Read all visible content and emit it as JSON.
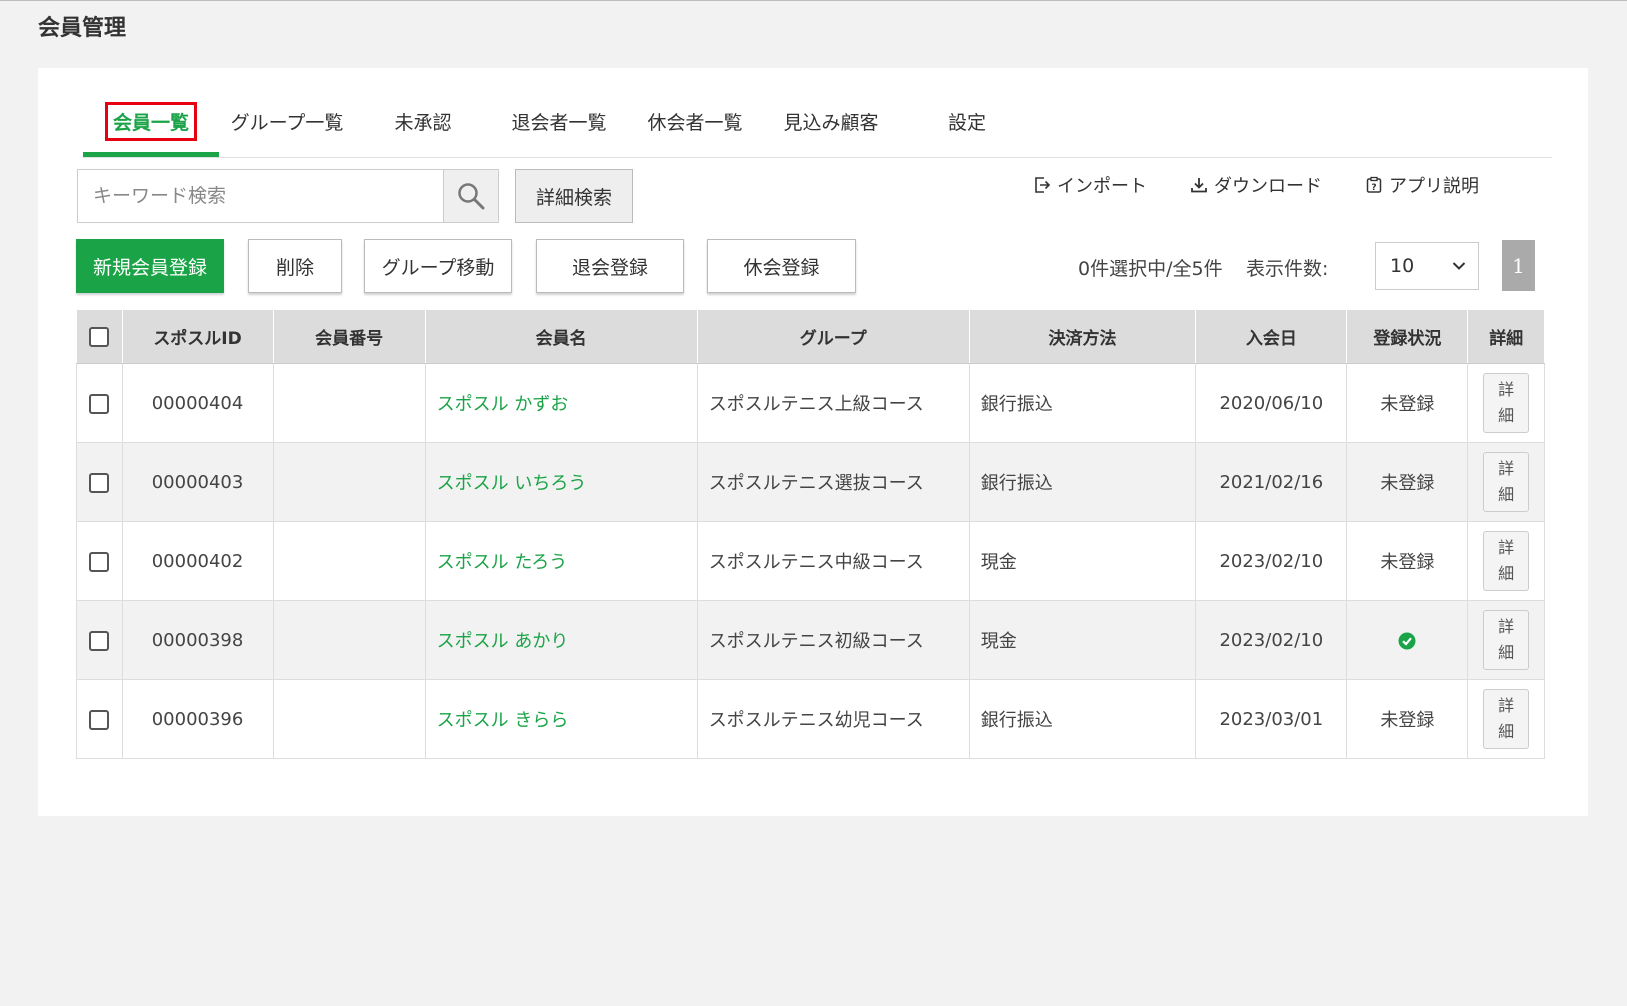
{
  "page_title": "会員管理",
  "tabs": [
    {
      "label": "会員一覧",
      "active": true
    },
    {
      "label": "グループ一覧"
    },
    {
      "label": "未承認"
    },
    {
      "label": "退会者一覧"
    },
    {
      "label": "休会者一覧"
    },
    {
      "label": "見込み顧客"
    },
    {
      "label": "設定"
    }
  ],
  "search": {
    "placeholder": "キーワード検索",
    "value": "",
    "icon": "search-icon",
    "advanced_label": "詳細検索"
  },
  "tools": {
    "import_label": "インポート",
    "download_label": "ダウンロード",
    "help_label": "アプリ説明"
  },
  "actions": {
    "new_member": "新規会員登録",
    "delete": "削除",
    "move_group": "グループ移動",
    "withdraw": "退会登録",
    "suspend": "休会登録"
  },
  "selection_text": "0件選択中/全5件",
  "per_page_label": "表示件数:",
  "per_page_value": "10",
  "pagination": {
    "current": "1"
  },
  "table": {
    "headers": [
      "スポスルID",
      "会員番号",
      "会員名",
      "グループ",
      "決済方法",
      "入会日",
      "登録状況",
      "詳細"
    ],
    "detail_label_top": "詳",
    "detail_label_bottom": "細",
    "rows": [
      {
        "id": "00000404",
        "number": "",
        "name": "スポスル かずお",
        "group": "スポスルテニス上級コース",
        "payment": "銀行振込",
        "joined": "2020/06/10",
        "status": "未登録",
        "registered": false
      },
      {
        "id": "00000403",
        "number": "",
        "name": "スポスル いちろう",
        "group": "スポスルテニス選抜コース",
        "payment": "銀行振込",
        "joined": "2021/02/16",
        "status": "未登録",
        "registered": false
      },
      {
        "id": "00000402",
        "number": "",
        "name": "スポスル たろう",
        "group": "スポスルテニス中級コース",
        "payment": "現金",
        "joined": "2023/02/10",
        "status": "未登録",
        "registered": false
      },
      {
        "id": "00000398",
        "number": "",
        "name": "スポスル あかり",
        "group": "スポスルテニス初級コース",
        "payment": "現金",
        "joined": "2023/02/10",
        "status": "",
        "registered": true
      },
      {
        "id": "00000396",
        "number": "",
        "name": "スポスル きらら",
        "group": "スポスルテニス幼児コース",
        "payment": "銀行振込",
        "joined": "2023/03/01",
        "status": "未登録",
        "registered": false
      }
    ]
  },
  "colors": {
    "accent": "#1ba447",
    "highlight": "#e60012",
    "header_bg": "#dcdcdc"
  }
}
